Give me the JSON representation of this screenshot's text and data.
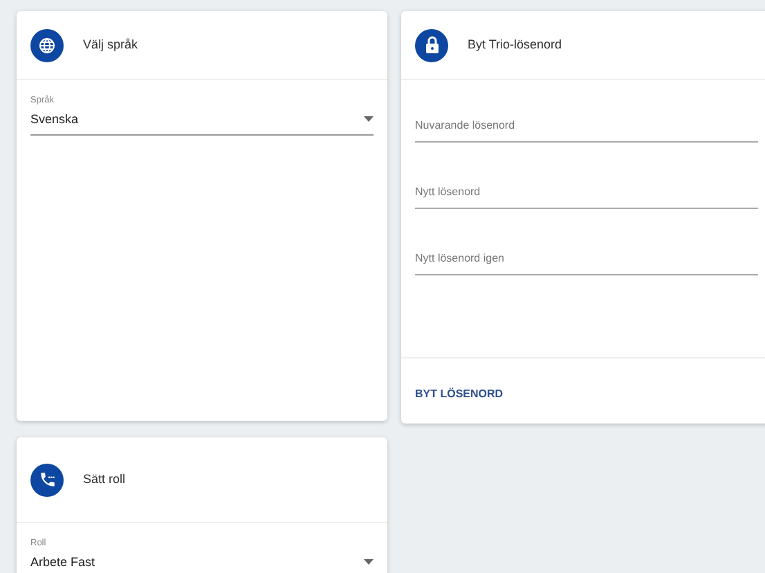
{
  "language_card": {
    "title": "Välj språk",
    "field": {
      "label": "Språk",
      "value": "Svenska"
    }
  },
  "password_card": {
    "title": "Byt Trio-lösenord",
    "fields": [
      {
        "placeholder": "Nuvarande lösenord"
      },
      {
        "placeholder": "Nytt lösenord"
      },
      {
        "placeholder": "Nytt lösenord igen"
      }
    ],
    "action": "BYT LÖSENORD"
  },
  "role_card": {
    "title": "Sätt roll",
    "field": {
      "label": "Roll",
      "value": "Arbete Fast"
    }
  }
}
